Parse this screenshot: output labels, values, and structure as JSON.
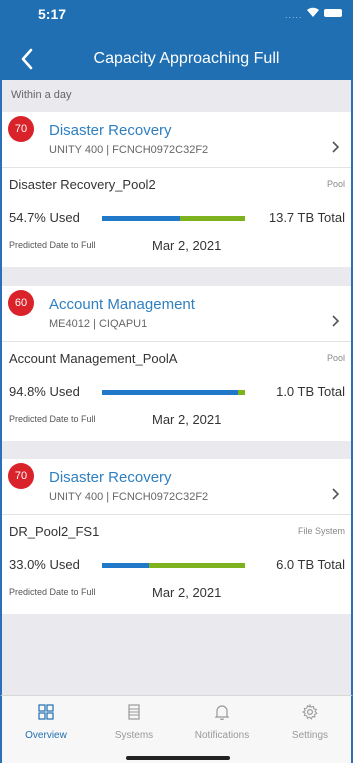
{
  "status_bar": {
    "time": "5:17",
    "carrier_dots": "....."
  },
  "header": {
    "title": "Capacity Approaching Full"
  },
  "section": {
    "label": "Within a day"
  },
  "cards": [
    {
      "badge": "70",
      "host_name": "Disaster Recovery",
      "host_sub": "UNITY 400 | FCNCH0972C32F2",
      "pool_name": "Disaster Recovery_Pool2",
      "pool_type": "Pool",
      "used_label": "54.7% Used",
      "used_fraction": 0.547,
      "total_label": "13.7 TB Total",
      "pred_label": "Predicted Date to Full",
      "pred_date": "Mar 2, 2021"
    },
    {
      "badge": "60",
      "host_name": "Account Management",
      "host_sub": "ME4012 | CIQAPU1",
      "pool_name": "Account Management_PoolA",
      "pool_type": "Pool",
      "used_label": "94.8% Used",
      "used_fraction": 0.948,
      "total_label": "1.0 TB Total",
      "pred_label": "Predicted Date to Full",
      "pred_date": "Mar 2, 2021"
    },
    {
      "badge": "70",
      "host_name": "Disaster Recovery",
      "host_sub": "UNITY 400 | FCNCH0972C32F2",
      "pool_name": "DR_Pool2_FS1",
      "pool_type": "File System",
      "used_label": "33.0% Used",
      "used_fraction": 0.33,
      "total_label": "6.0 TB Total",
      "pred_label": "Predicted Date to Full",
      "pred_date": "Mar 2, 2021"
    }
  ],
  "tabs": [
    {
      "label": "Overview",
      "icon": "overview-icon",
      "active": true
    },
    {
      "label": "Systems",
      "icon": "systems-icon",
      "active": false
    },
    {
      "label": "Notifications",
      "icon": "bell-icon",
      "active": false
    },
    {
      "label": "Settings",
      "icon": "gear-icon",
      "active": false
    }
  ],
  "colors": {
    "header": "#1f6fb2",
    "badge": "#d9222a",
    "link": "#2f7fc1",
    "bar_used": "#1f78c8",
    "bar_free": "#7fb21f"
  }
}
